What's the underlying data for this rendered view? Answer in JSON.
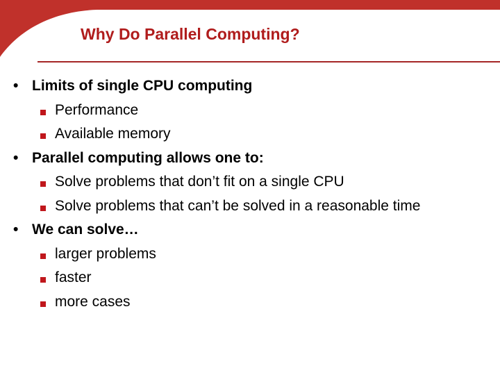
{
  "slide": {
    "title": "Why Do Parallel Computing?",
    "accent_color": "#c0312b",
    "items": [
      {
        "level": 1,
        "text": "Limits of single CPU computing"
      },
      {
        "level": 2,
        "text": "Performance"
      },
      {
        "level": 2,
        "text": "Available memory"
      },
      {
        "level": 1,
        "text": "Parallel computing allows one to:"
      },
      {
        "level": 2,
        "text": "Solve problems that don’t fit on a single CPU"
      },
      {
        "level": 2,
        "text": "Solve problems that can’t be solved in a reasonable time"
      },
      {
        "level": 1,
        "text": "We can solve…"
      },
      {
        "level": 2,
        "text": "larger problems"
      },
      {
        "level": 2,
        "text": "faster"
      },
      {
        "level": 2,
        "text": "more cases"
      }
    ],
    "bullet_l1": "•"
  }
}
